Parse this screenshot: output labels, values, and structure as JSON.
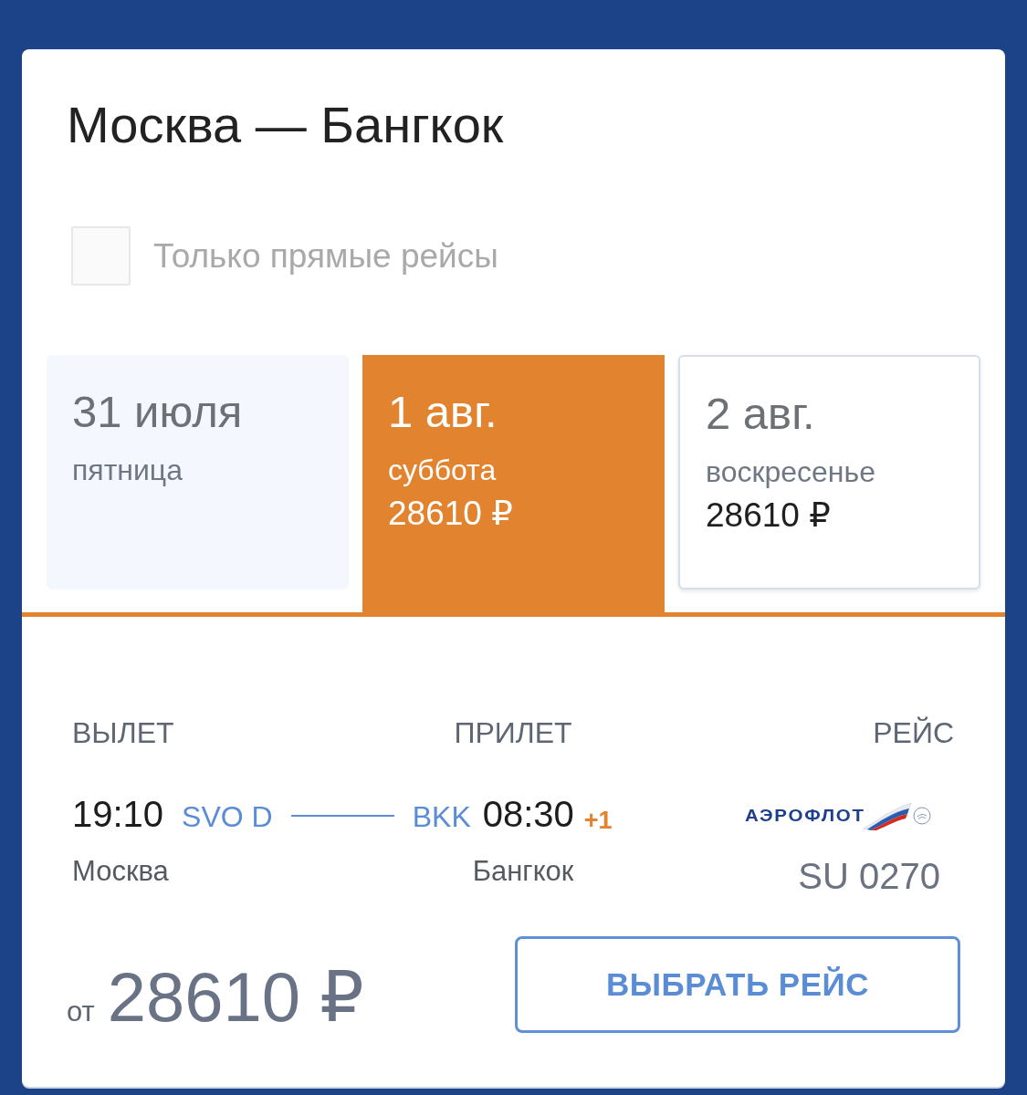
{
  "route_title": "Москва — Бангкок",
  "direct_only": {
    "label": "Только прямые рейсы",
    "checked": false
  },
  "dates": [
    {
      "date": "31 июля",
      "weekday": "пятница",
      "selected": false
    },
    {
      "date": "1 авг.",
      "weekday": "суббота",
      "price": "28610 ₽",
      "selected": true
    },
    {
      "date": "2 авг.",
      "weekday": "воскресенье",
      "price": "28610 ₽",
      "selected": false
    }
  ],
  "flight": {
    "columns": [
      "ВЫЛЕТ",
      "ПРИЛЕТ",
      "РЕЙС"
    ],
    "departure": {
      "time": "19:10",
      "airport": "SVO D",
      "city": "Москва"
    },
    "arrival": {
      "airport": "BKK",
      "time": "08:30",
      "day_offset": "+1",
      "city": "Бангкок"
    },
    "airline": {
      "logo_text": "АЭРОФЛОТ"
    },
    "flight_number": "SU 0270"
  },
  "price": {
    "prefix": "от",
    "amount": "28610 ₽"
  },
  "select_button": "ВЫБРАТЬ РЕЙС"
}
